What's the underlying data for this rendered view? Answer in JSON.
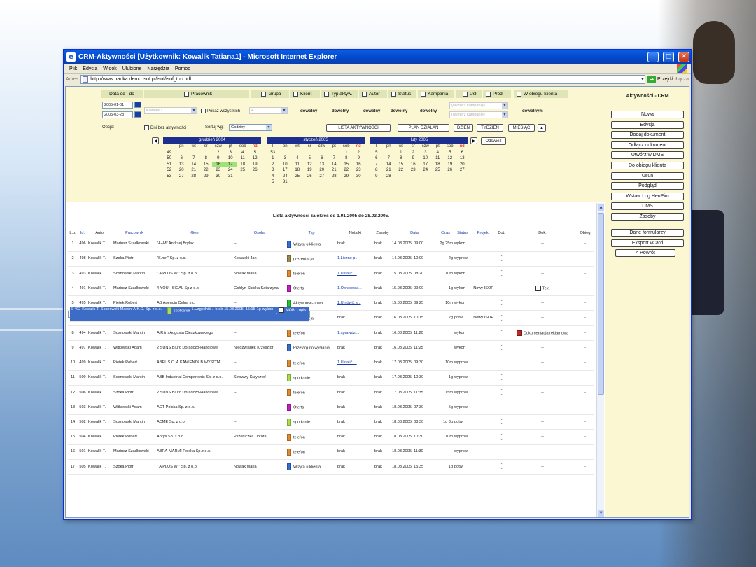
{
  "window": {
    "title": "CRM-Aktywności [Użytkownik: Kowalik Tatiana1] - Microsoft Internet Explorer",
    "menu": [
      "Plik",
      "Edycja",
      "Widok",
      "Ulubione",
      "Narzędzia",
      "Pomoc"
    ],
    "address_label": "Adres",
    "url": "http://www.nauka.demo.isof.pl/isof/isof_top.hdb",
    "go_label": "Przejdź",
    "links_label": "Łącza"
  },
  "filters": {
    "date_label": "Data od - do",
    "date_from": "2005-01-01",
    "date_to": "2005-03-28",
    "options_label": "Opcje:",
    "pracownik_label": "Pracownik",
    "pracownik_value": "Kowalik T.",
    "show_all_label": "Pokaż wszystkich",
    "group_select_value": "A1",
    "grupa_label": "Grupa",
    "klient_label": "Klient",
    "typ_label": "Typ aktyw.",
    "autor_label": "Autor",
    "status_label": "Status",
    "kampania_label": "Kampania",
    "usl_label": "Usł.",
    "prod_label": "Prod.",
    "obieg_label": "W obiegu klienta",
    "any": "dowolny",
    "any_m": "dowolnym",
    "campaign_placeholder": "(wybierz kampanię)",
    "days_without_label": "Dni bez aktywności",
    "sort_label": "Sortuj wg:",
    "sort_value": "Godziny",
    "btn_lista": "LISTA AKTYWNOŚCI",
    "btn_plan": "PLAN DZIAŁAŃ",
    "btn_dzien": "DZIEŃ",
    "btn_tydzien": "TYDZIEŃ",
    "btn_miesiac": "MIESIĄC",
    "btn_odswiez": "Odśwież"
  },
  "calendars": [
    {
      "title": "grudzień 2004",
      "head": [
        "T",
        "pn",
        "wt",
        "śr",
        "czw",
        "pt",
        "sob",
        "nd"
      ],
      "rows": [
        [
          "49",
          "",
          "",
          "1",
          "2",
          "3",
          "4",
          "5"
        ],
        [
          "50",
          "6",
          "7",
          "8",
          "9",
          "10",
          "11",
          "12"
        ],
        [
          "51",
          "13",
          "14",
          "15",
          "16",
          "17",
          "18",
          "19"
        ],
        [
          "52",
          "20",
          "21",
          "22",
          "23",
          "24",
          "25",
          "26"
        ],
        [
          "53",
          "27",
          "28",
          "29",
          "30",
          "31",
          "",
          ""
        ]
      ]
    },
    {
      "title": "styczeń 2005",
      "head": [
        "T",
        "pn",
        "wt",
        "śr",
        "czw",
        "pt",
        "sob",
        "nd"
      ],
      "rows": [
        [
          "53",
          "",
          "",
          "",
          "",
          "",
          "1",
          "2"
        ],
        [
          "1",
          "3",
          "4",
          "5",
          "6",
          "7",
          "8",
          "9"
        ],
        [
          "2",
          "10",
          "11",
          "12",
          "13",
          "14",
          "15",
          "16"
        ],
        [
          "3",
          "17",
          "18",
          "19",
          "20",
          "21",
          "22",
          "23"
        ],
        [
          "4",
          "24",
          "25",
          "26",
          "27",
          "28",
          "29",
          "30"
        ],
        [
          "5",
          "31",
          "",
          "",
          "",
          "",
          "",
          ""
        ]
      ]
    },
    {
      "title": "luty 2005",
      "head": [
        "T",
        "pn",
        "wt",
        "śr",
        "czw",
        "pt",
        "sob",
        "nd"
      ],
      "rows": [
        [
          "5",
          "",
          "1",
          "2",
          "3",
          "4",
          "5",
          "6"
        ],
        [
          "6",
          "7",
          "8",
          "9",
          "10",
          "11",
          "12",
          "13"
        ],
        [
          "7",
          "14",
          "15",
          "16",
          "17",
          "18",
          "19",
          "20"
        ],
        [
          "8",
          "21",
          "22",
          "23",
          "24",
          "25",
          "26",
          "27"
        ],
        [
          "9",
          "28",
          "",
          "",
          "",
          "",
          "",
          ""
        ]
      ]
    }
  ],
  "list": {
    "title": "Lista aktywności za okres od 1.01.2005 do 28.03.2005.",
    "headers": [
      "L.p.",
      "Id.",
      "Autor",
      "Pracownik",
      "Klient",
      "Osoba",
      "Typ",
      "Notatki",
      "Zasoby",
      "Data",
      "Czas",
      "Status",
      "Projekt",
      "Dot.",
      "Dok.",
      "Obieg"
    ],
    "rows": [
      {
        "lp": "1",
        "id": "496",
        "autor": "Kowalik T.",
        "prac": "Mariusz Szadkowski",
        "klient": "\"A+M\" Andrzej Brylak",
        "osoba": "--",
        "typ": "Wizyta u klienta",
        "typ_color": "#2f6fd6",
        "notatki": "brak",
        "notatki_link": false,
        "zasoby": "brak",
        "data": "14.03.2005, 09:00",
        "czas": "2g 25m",
        "status": "wykon",
        "projekt": "",
        "dot": "-\n-",
        "dok": "--",
        "dok_icon": "",
        "obieg": "-"
      },
      {
        "lp": "2",
        "id": "498",
        "autor": "Kowalik T.",
        "prac": "Szoka Piotr",
        "klient": "\"S.net\" Sp. z o.o.",
        "osoba": "Kowalski Jan",
        "typ": "prezentacja",
        "typ_color": "#9a8a4a",
        "notatki": "1.Liczne p...",
        "notatki_link": true,
        "zasoby": "brak",
        "data": "14.03.2005, 10:00",
        "czas": "2g",
        "status": "wyprow",
        "projekt": "",
        "dot": "-\n-",
        "dok": "--",
        "dok_icon": "",
        "obieg": "-"
      },
      {
        "lp": "3",
        "id": "493",
        "autor": "Kowalik T.",
        "prac": "Sosnowski Marcin",
        "klient": "\" A PLUS W \" Sp. z o.o.",
        "osoba": "Nowak Maria",
        "typ": "telefon",
        "typ_color": "#e58a2b",
        "notatki": "1.Ustalić ...",
        "notatki_link": true,
        "zasoby": "brak",
        "data": "15.03.2005, 08:20",
        "czas": "10m",
        "status": "wykon",
        "projekt": "",
        "dot": "-\n-",
        "dok": "--",
        "dok_icon": "",
        "obieg": "-"
      },
      {
        "lp": "4",
        "id": "491",
        "autor": "Kowalik T.",
        "prac": "Mariusz Szadkowski",
        "klient": "4 YOU - SIGAL Sp.z o.o.",
        "osoba": "Gołdyn-Skórka Katarzyna",
        "typ": "Oferta",
        "typ_color": "#c21fc2",
        "notatki": "1.Opracowa...",
        "notatki_link": true,
        "zasoby": "brak",
        "data": "15.03.2005, 09:00",
        "czas": "1g",
        "status": "wykon",
        "projekt": "Nowy ISOF",
        "dot": "-\n-",
        "dok": "Text",
        "dok_icon": "doc",
        "obieg": "-"
      },
      {
        "lp": "5",
        "id": "495",
        "autor": "Kowalik T.",
        "prac": "Pietek Robert",
        "klient": "AB Agencja Celna s.c.",
        "osoba": "--",
        "typ": "Aktywnosc-nowa",
        "typ_color": "#22c22c",
        "notatki": "1.Umówić s...",
        "notatki_link": true,
        "zasoby": "brak",
        "data": "15.03.2005, 09:25",
        "czas": "10m",
        "status": "wykon",
        "projekt": "",
        "dot": "-\n-",
        "dok": "--",
        "dok_icon": "",
        "obieg": "-"
      },
      {
        "lp": "6",
        "id": "492",
        "autor": "Kowalik T.",
        "prac": "Sosnowski Marcin",
        "klient": "A.K.O. Sp. z o.o.",
        "osoba": "--",
        "typ": "spotkanie",
        "typ_color": "#a8e04a",
        "notatki": "1.Uzgodnić...",
        "notatki_link": true,
        "zasoby": "brak",
        "data": "15.03.2005, 15:15",
        "czas": "1g",
        "status": "wykon",
        "projekt": "",
        "dot": "-\n-",
        "dok": "MOBI - opis",
        "dok_icon": "doc",
        "obieg": "-",
        "selected": true
      },
      {
        "lp": "7",
        "id": "490",
        "autor": "Kowalik T.",
        "prac": "Pietek Robert",
        "klient": "A.U.F.K.",
        "osoba": "",
        "typ": "prezentacja",
        "typ_color": "#9a8a4a",
        "notatki": "brak",
        "notatki_link": false,
        "zasoby": "brak",
        "data": "16.03.2005, 10:15",
        "czas": "2g",
        "status": "potwi",
        "projekt": "Nowy ISOF",
        "dot": "-\n-",
        "dok": "--",
        "dok_icon": "",
        "obieg": "-"
      },
      {
        "lp": "8",
        "id": "494",
        "autor": "Kowalik T.",
        "prac": "Sosnowski Marcin",
        "klient": "A.R.im.Augusta Cieszkowskiego",
        "osoba": "--",
        "typ": "telefon",
        "typ_color": "#e58a2b",
        "notatki": "1.sprawdzi...",
        "notatki_link": true,
        "zasoby": "brak",
        "data": "16.03.2005, 11:20",
        "czas": "",
        "status": "wykon",
        "projekt": "",
        "dot": "-\n-",
        "dok": "Dokumentacja reklamowa",
        "dok_icon": "red",
        "obieg": "-"
      },
      {
        "lp": "9",
        "id": "497",
        "autor": "Kowalik T.",
        "prac": "Witkowski Adam",
        "klient": "2 SUNS Biuro Doradczo-Handlowe",
        "osoba": "Niedźwiadek Krzysztof",
        "typ": "Przetarg do wysłania",
        "typ_color": "#2f6fd6",
        "notatki": "brak",
        "notatki_link": false,
        "zasoby": "brak",
        "data": "16.03.2005, 11:25",
        "czas": "",
        "status": "wykon",
        "projekt": "",
        "dot": "-\n-",
        "dok": "--",
        "dok_icon": "",
        "obieg": "-"
      },
      {
        "lp": "10",
        "id": "499",
        "autor": "Kowalik T.",
        "prac": "Pietek Robert",
        "klient": "ABEL S.C. A.KAMIENI'K B.WYSOTA",
        "osoba": "--",
        "typ": "telefon",
        "typ_color": "#e58a2b",
        "notatki": "1.Ustalić ...",
        "notatki_link": true,
        "zasoby": "brak",
        "data": "17.03.2005, 09:30",
        "czas": "10m",
        "status": "wyprow",
        "projekt": "",
        "dot": "-\n-",
        "dok": "--",
        "dok_icon": "",
        "obieg": "-"
      },
      {
        "lp": "11",
        "id": "500",
        "autor": "Kowalik T.",
        "prac": "Sosnowski Marcin",
        "klient": "ABB Industrial Components Sp. z o.o.",
        "osoba": "Strowwy Krzysztof",
        "typ": "spotkanie",
        "typ_color": "#a8e04a",
        "notatki": "brak",
        "notatki_link": false,
        "zasoby": "brak",
        "data": "17.03.2005, 10:30",
        "czas": "1g",
        "status": "wyprow",
        "projekt": "",
        "dot": "-\n-",
        "dok": "--",
        "dok_icon": "",
        "obieg": "-"
      },
      {
        "lp": "12",
        "id": "506",
        "autor": "Kowalik T.",
        "prac": "Szoka Piotr",
        "klient": "2 SUNS Biuro Doradczo-Handlowe",
        "osoba": "--",
        "typ": "telefon",
        "typ_color": "#e58a2b",
        "notatki": "brak",
        "notatki_link": false,
        "zasoby": "brak",
        "data": "17.03.2005, 11:35",
        "czas": "15m",
        "status": "wyprow",
        "projekt": "",
        "dot": "-\n-",
        "dok": "--",
        "dok_icon": "",
        "obieg": "-"
      },
      {
        "lp": "13",
        "id": "503",
        "autor": "Kowalik T.",
        "prac": "Witkowski Adam",
        "klient": "ACT Polska Sp. z o.o.",
        "osoba": "--",
        "typ": "Oferta",
        "typ_color": "#c21fc2",
        "notatki": "brak",
        "notatki_link": false,
        "zasoby": "brak",
        "data": "18.03.2005, 07:30",
        "czas": "5g",
        "status": "wyprow",
        "projekt": "",
        "dot": "-\n-",
        "dok": "--",
        "dok_icon": "",
        "obieg": "-"
      },
      {
        "lp": "14",
        "id": "502",
        "autor": "Kowalik T.",
        "prac": "Sosnowski Marcin",
        "klient": "ACME Sp. z o.o.",
        "osoba": "--",
        "typ": "spotkanie",
        "typ_color": "#a8e04a",
        "notatki": "brak",
        "notatki_link": false,
        "zasoby": "brak",
        "data": "18.03.2005, 08:30",
        "czas": "1d 3g",
        "status": "potwi",
        "projekt": "",
        "dot": "-\n-",
        "dok": "--",
        "dok_icon": "",
        "obieg": "-"
      },
      {
        "lp": "15",
        "id": "504",
        "autor": "Kowalik T.",
        "prac": "Pietek Robert",
        "klient": "Abrys Sp. z o.o.",
        "osoba": "Pszeniczka Dorota",
        "typ": "telefon",
        "typ_color": "#e58a2b",
        "notatki": "brak",
        "notatki_link": false,
        "zasoby": "brak",
        "data": "18.03.2005, 10:30",
        "czas": "10m",
        "status": "wyprow",
        "projekt": "",
        "dot": "-\n-",
        "dok": "--",
        "dok_icon": "",
        "obieg": "-"
      },
      {
        "lp": "16",
        "id": "501",
        "autor": "Kowalik T.",
        "prac": "Mariusz Szadkowski",
        "klient": "ABRA-MARMI Polska Sp.z o.o.",
        "osoba": "--",
        "typ": "telefon",
        "typ_color": "#e58a2b",
        "notatki": "brak",
        "notatki_link": false,
        "zasoby": "brak",
        "data": "18.03.2005, 11:30",
        "czas": "",
        "status": "wyprow",
        "projekt": "",
        "dot": "-\n-",
        "dok": "--",
        "dok_icon": "",
        "obieg": "-"
      },
      {
        "lp": "17",
        "id": "505",
        "autor": "Kowalik T.",
        "prac": "Szoka Piotr",
        "klient": "\" A PLUS W \" Sp. z o.o.",
        "osoba": "Nowak Maria",
        "typ": "Wizyta u klienta",
        "typ_color": "#2f6fd6",
        "notatki": "brak",
        "notatki_link": false,
        "zasoby": "brak",
        "data": "18.03.2005, 15:35",
        "czas": "1g",
        "status": "potwi",
        "projekt": "",
        "dot": "-\n-",
        "dok": "--",
        "dok_icon": "",
        "obieg": "-"
      }
    ]
  },
  "sidebar": {
    "title": "Aktywności - CRM",
    "buttons": [
      "Nowa",
      "Edycja",
      "Dodaj dokument",
      "Odłącz dokument",
      "Utwórz w DMS",
      "Do obiegu klienta",
      "Usuń",
      "Podgląd",
      "Wstaw Log HeuPim",
      "DMS",
      "Zasoby"
    ],
    "buttons2": [
      "Dane formularzy",
      "Eksport vCard",
      "< Powrót"
    ]
  }
}
